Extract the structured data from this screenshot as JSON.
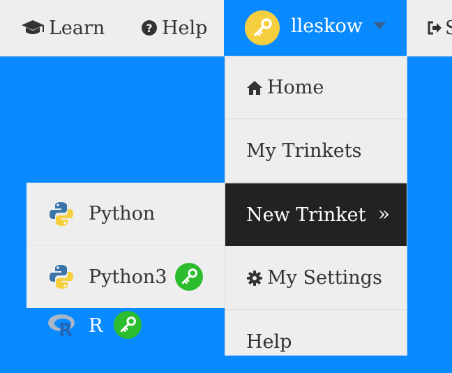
{
  "topbar": {
    "learn_label": "Learn",
    "help_label": "Help",
    "username": "lleskow",
    "signout_label": "S"
  },
  "user_menu": {
    "items": [
      {
        "label": "Home",
        "icon": "home-icon"
      },
      {
        "label": "My Trinkets"
      },
      {
        "label": "New Trinket",
        "suffix": "»"
      },
      {
        "label": "My Settings",
        "icon": "gear-icon"
      },
      {
        "label": "Help"
      }
    ]
  },
  "new_trinket_menu": {
    "items": [
      {
        "label": "Python",
        "icon": "python-logo-icon"
      },
      {
        "label": "Python3",
        "icon": "python-logo-icon",
        "badge": "key-icon"
      },
      {
        "label": "R",
        "icon": "r-logo-icon",
        "badge": "key-icon"
      }
    ]
  },
  "colors": {
    "accent_blue": "#0a8aff",
    "menu_bg": "#eeeeee",
    "active_bg": "#222222",
    "avatar_yellow": "#f5cf3f",
    "key_badge_green": "#2bbd2e"
  }
}
